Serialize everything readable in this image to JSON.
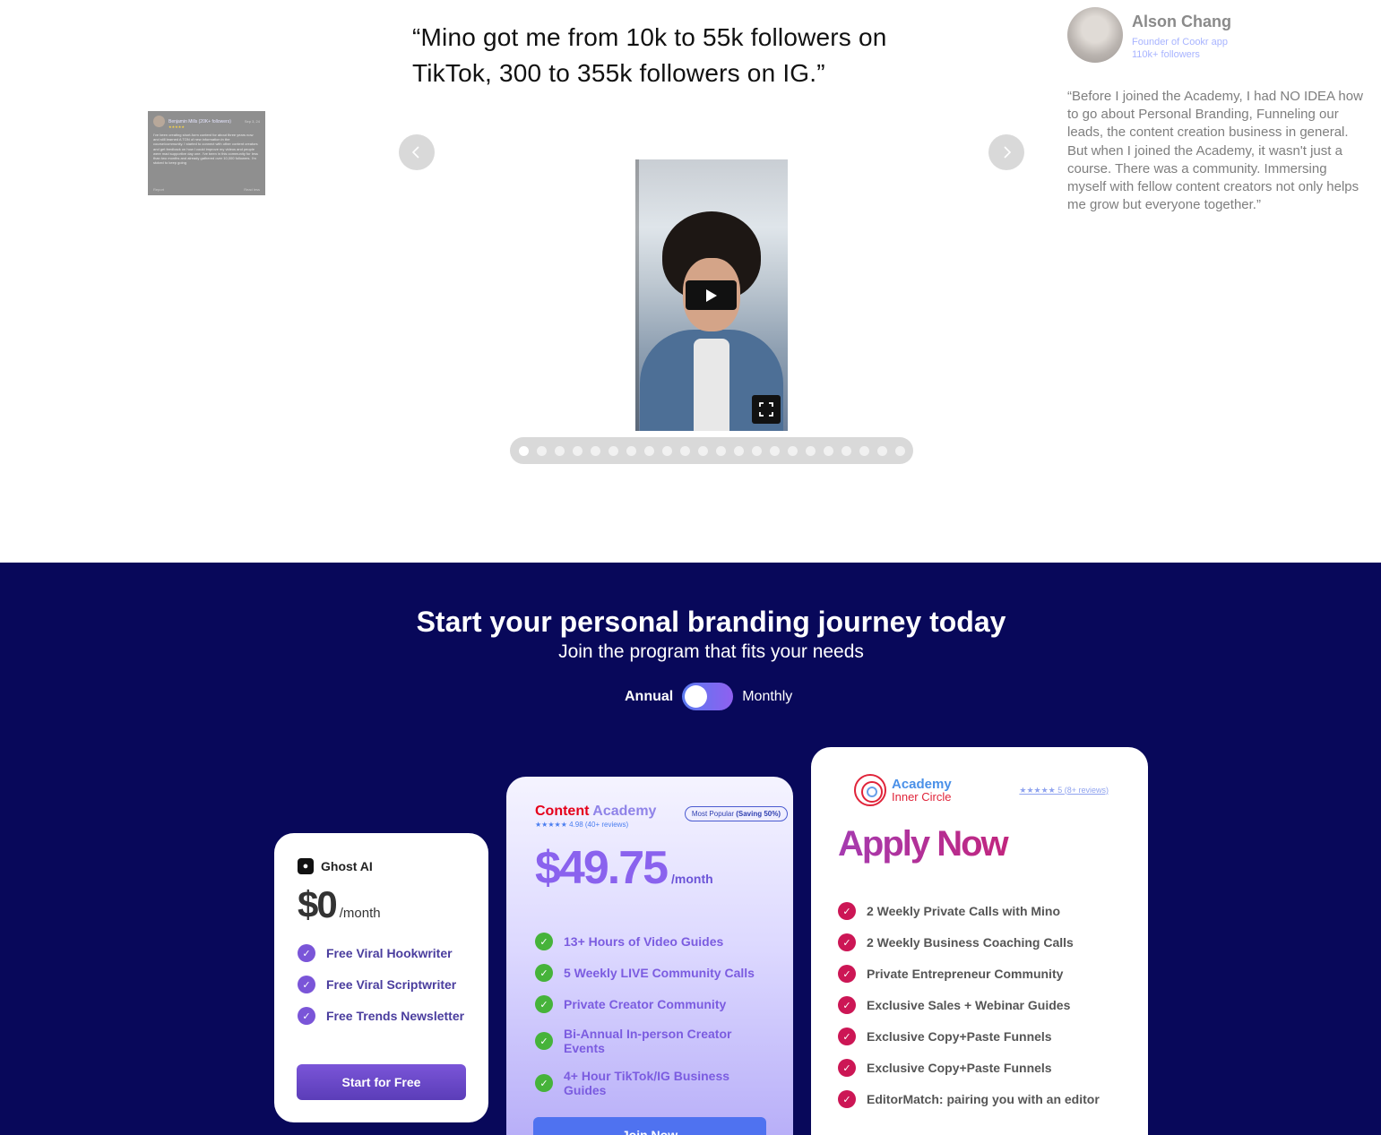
{
  "testimonials": {
    "quote": "“Mino got me from 10k to 55k followers on TikTok, 300 to 355k followers on IG.”",
    "review_card": {
      "name": "Benjamin Mills (20K+ followers)",
      "date": "Sep 3, 24",
      "stars": "★★★★★",
      "body": "I've been creating short-form content for about three years now and still learned A TON of new information in the course/community. I started to connect with other content creators and get feedback on how I could improve my videos and people were mad supportive day one. I've been in this community for less than two months and already gathered over 10,000 followers. I'm stoked to keep going",
      "report": "Report",
      "read_less": "Read less"
    },
    "prev_icon": "chevron-left-icon",
    "next_icon": "chevron-right-icon",
    "video": {
      "play_icon": "play-icon",
      "fullscreen_icon": "fullscreen-icon"
    },
    "dot_count": 22,
    "active_dot": 0,
    "profile": {
      "name": "Alson Chang",
      "role": "Founder of Cookr app",
      "followers": "110k+ followers",
      "text": "“Before I joined the Academy, I had NO IDEA how to go about Personal Branding, Funneling our leads, the content creation business in general.\nBut when I joined the Academy, it wasn't just a course. There was a community. Immersing myself with fellow content creators not only helps me grow but everyone together.”"
    }
  },
  "pricing": {
    "title": "Start your personal branding journey today",
    "subtitle": "Join the program that fits your needs",
    "toggle": {
      "annual": "Annual",
      "monthly": "Monthly"
    },
    "ghost": {
      "name": "Ghost AI",
      "price": "$0",
      "per": "/month",
      "features": [
        "Free Viral Hookwriter",
        "Free Viral Scriptwriter",
        "Free Trends Newsletter"
      ],
      "button": "Start for Free"
    },
    "academy": {
      "name_a": "Content",
      "name_b": " Academy",
      "rating": "★★★★★ 4.98 (40+ reviews)",
      "badge_a": "Most Popular ",
      "badge_b": "(Saving 50%)",
      "price": "$49.75",
      "per": "/month",
      "features": [
        "13+ Hours of Video Guides",
        "5 Weekly LIVE Community Calls",
        "Private Creator Community",
        "Bi-Annual In-person Creator Events",
        "4+ Hour TikTok/IG Business Guides"
      ],
      "button": "Join Now"
    },
    "inner": {
      "logo_t1": "Academy",
      "logo_t2": "Inner Circle",
      "rating": "★★★★★ 5 (8+ reviews)",
      "heading": "Apply Now",
      "features": [
        "2 Weekly Private Calls with Mino",
        "2 Weekly Business Coaching Calls",
        "Private Entrepreneur Community",
        "Exclusive Sales + Webinar Guides",
        "Exclusive Copy+Paste Funnels",
        "Exclusive Copy+Paste Funnels",
        "EditorMatch: pairing you with an editor"
      ]
    }
  }
}
